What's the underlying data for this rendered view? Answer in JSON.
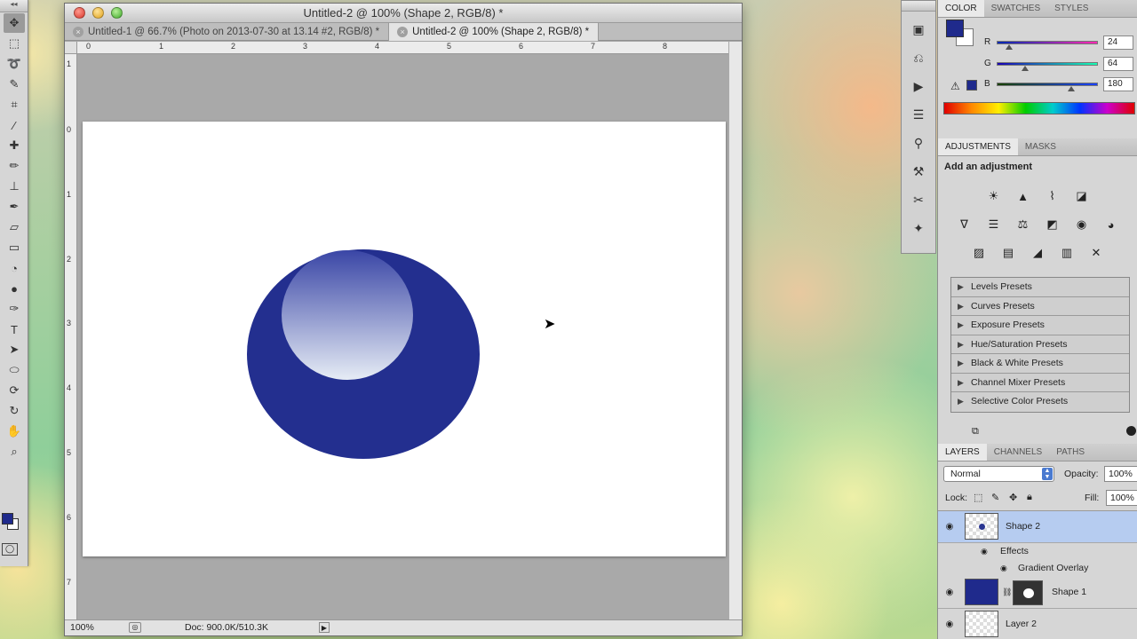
{
  "document": {
    "title": "Untitled-2 @ 100% (Shape 2, RGB/8) *",
    "tabs": [
      {
        "label": "Untitled-1 @ 66.7% (Photo on 2013-07-30 at 13.14 #2, RGB/8) *",
        "active": false
      },
      {
        "label": "Untitled-2 @ 100% (Shape 2, RGB/8) *",
        "active": true
      }
    ],
    "ruler_h": [
      "0",
      "1",
      "2",
      "3",
      "4",
      "5",
      "6",
      "7",
      "8"
    ],
    "ruler_v": [
      "1",
      "0",
      "1",
      "2",
      "3",
      "4",
      "5",
      "6",
      "7"
    ],
    "status": {
      "zoom": "100%",
      "doc_size": "Doc: 900.0K/510.3K"
    }
  },
  "shape": {
    "fill": "#232f8f",
    "highlight_top": "#3a46a6",
    "highlight_bottom": "#e6ecf5"
  },
  "tools": {
    "items": [
      "move-tool",
      "marquee-tool",
      "lasso-tool",
      "quick-select-tool",
      "crop-tool",
      "eyedropper-tool",
      "healing-tool",
      "brush-tool",
      "clone-stamp-tool",
      "history-brush-tool",
      "eraser-tool",
      "gradient-tool",
      "blur-tool",
      "dodge-tool",
      "pen-tool",
      "type-tool",
      "path-select-tool",
      "shape-tool",
      "3d-rotate-tool",
      "3d-orbit-tool",
      "hand-tool",
      "zoom-tool"
    ],
    "foreground": "#1f2a8c",
    "background": "#ffffff"
  },
  "color_panel": {
    "tabs": [
      "COLOR",
      "SWATCHES",
      "STYLES"
    ],
    "r": {
      "label": "R",
      "value": "24",
      "pct": 0.094
    },
    "g": {
      "label": "G",
      "value": "64",
      "pct": 0.251
    },
    "b": {
      "label": "B",
      "value": "180",
      "pct": 0.706
    }
  },
  "adjustments": {
    "tabs": [
      "ADJUSTMENTS",
      "MASKS"
    ],
    "heading": "Add an adjustment",
    "presets": [
      "Levels Presets",
      "Curves Presets",
      "Exposure Presets",
      "Hue/Saturation Presets",
      "Black & White Presets",
      "Channel Mixer Presets",
      "Selective Color Presets"
    ]
  },
  "layers": {
    "tabs": [
      "LAYERS",
      "CHANNELS",
      "PATHS"
    ],
    "blend_mode": "Normal",
    "opacity_label": "Opacity:",
    "opacity": "100%",
    "lock_label": "Lock:",
    "fill_label": "Fill:",
    "fill": "100%",
    "items": [
      {
        "name": "Shape 2",
        "selected": true
      },
      {
        "name": "Effects",
        "sub": true
      },
      {
        "name": "Gradient Overlay",
        "sub": true
      },
      {
        "name": "Shape 1",
        "selected": false
      },
      {
        "name": "Layer 2",
        "selected": false
      }
    ]
  },
  "accent": "#b6ccf0"
}
